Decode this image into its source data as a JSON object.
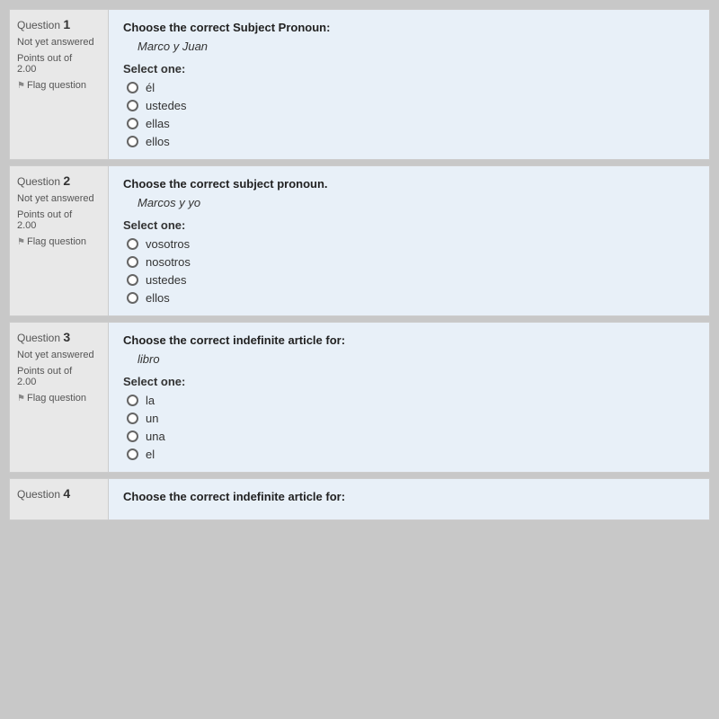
{
  "questions": [
    {
      "id": "question-1",
      "number": "1",
      "status": "Not yet answered",
      "points_label": "Points out of",
      "points_value": "2.00",
      "flag_label": "Flag question",
      "title": "Choose the correct Subject Pronoun:",
      "subject": "Marco y Juan",
      "select_label": "Select one:",
      "options": [
        "él",
        "ustedes",
        "ellas",
        "ellos"
      ]
    },
    {
      "id": "question-2",
      "number": "2",
      "status": "Not yet answered",
      "points_label": "Points out of",
      "points_value": "2.00",
      "flag_label": "Flag question",
      "title": "Choose the correct subject pronoun.",
      "subject": "Marcos y yo",
      "select_label": "Select one:",
      "options": [
        "vosotros",
        "nosotros",
        "ustedes",
        "ellos"
      ]
    },
    {
      "id": "question-3",
      "number": "3",
      "status": "Not yet answered",
      "points_label": "Points out of",
      "points_value": "2.00",
      "flag_label": "Flag question",
      "title": "Choose the correct indefinite article for:",
      "subject": "libro",
      "select_label": "Select one:",
      "options": [
        "la",
        "un",
        "una",
        "el"
      ]
    },
    {
      "id": "question-4",
      "number": "4",
      "status": "",
      "points_label": "",
      "points_value": "",
      "flag_label": "",
      "title": "Choose the correct indefinite article for:",
      "subject": "",
      "select_label": "",
      "options": []
    }
  ],
  "labels": {
    "question_prefix": "Question",
    "not_yet_answered": "Not yet answered",
    "points_out_of": "Points out of",
    "flag_question": "Flag question"
  }
}
